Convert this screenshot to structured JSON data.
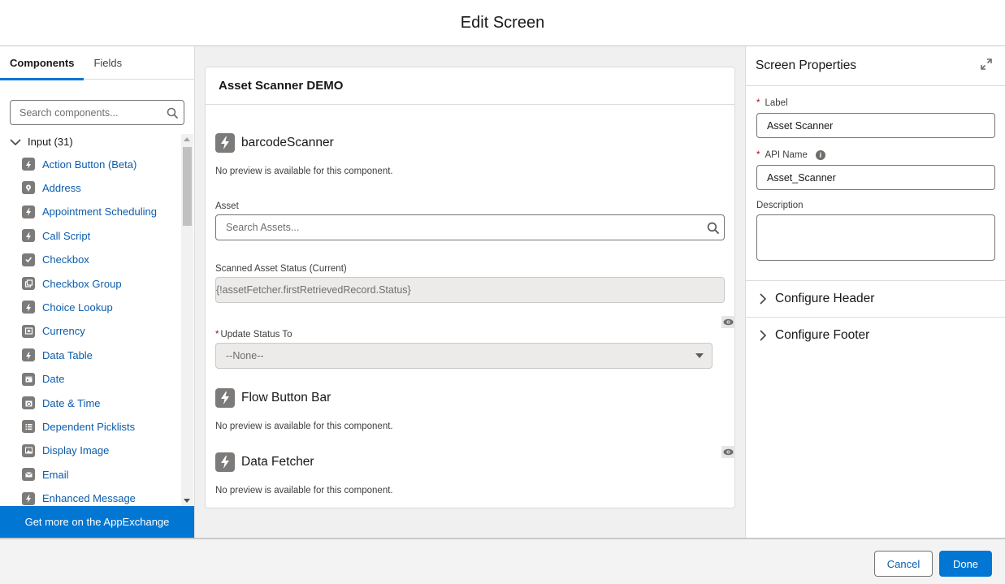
{
  "window": {
    "title": "Edit Screen"
  },
  "left_panel": {
    "tabs": [
      {
        "label": "Components",
        "active": true
      },
      {
        "label": "Fields",
        "active": false
      }
    ],
    "search": {
      "placeholder": "Search components...",
      "value": ""
    },
    "group": {
      "label": "Input (31)",
      "expanded": true
    },
    "items": [
      {
        "label": "Action Button (Beta)",
        "icon": "bolt-icon"
      },
      {
        "label": "Address",
        "icon": "location-pin-icon"
      },
      {
        "label": "Appointment Scheduling",
        "icon": "bolt-icon"
      },
      {
        "label": "Call Script",
        "icon": "bolt-icon"
      },
      {
        "label": "Checkbox",
        "icon": "checkbox-icon"
      },
      {
        "label": "Checkbox Group",
        "icon": "checkbox-group-icon"
      },
      {
        "label": "Choice Lookup",
        "icon": "bolt-icon"
      },
      {
        "label": "Currency",
        "icon": "currency-icon"
      },
      {
        "label": "Data Table",
        "icon": "bolt-icon"
      },
      {
        "label": "Date",
        "icon": "calendar-icon"
      },
      {
        "label": "Date & Time",
        "icon": "calendar-time-icon"
      },
      {
        "label": "Dependent Picklists",
        "icon": "list-icon"
      },
      {
        "label": "Display Image",
        "icon": "image-icon"
      },
      {
        "label": "Email",
        "icon": "email-icon"
      },
      {
        "label": "Enhanced Message",
        "icon": "bolt-icon"
      }
    ],
    "appexchange_label": "Get more on the AppExchange"
  },
  "canvas": {
    "screen_title": "Asset Scanner DEMO",
    "components": [
      {
        "name": "barcodeScanner",
        "note": "No preview is available for this component."
      },
      {
        "name": "Flow Button Bar",
        "note": "No preview is available for this component."
      },
      {
        "name": "Data Fetcher",
        "note": "No preview is available for this component."
      }
    ],
    "asset_field": {
      "label": "Asset",
      "placeholder": "Search Assets..."
    },
    "status_field": {
      "label": "Scanned Asset Status (Current)",
      "value": "{!assetFetcher.firstRetrievedRecord.Status}"
    },
    "update_field": {
      "required_mark": "*",
      "label": "Update Status To",
      "value": "--None--"
    }
  },
  "properties": {
    "title": "Screen Properties",
    "label_field": {
      "required_mark": "*",
      "label": "Label",
      "value": "Asset Scanner"
    },
    "api_field": {
      "required_mark": "*",
      "label": "API Name",
      "value": "Asset_Scanner",
      "info_glyph": "i"
    },
    "description_field": {
      "label": "Description",
      "value": ""
    },
    "sections": [
      {
        "label": "Configure Header"
      },
      {
        "label": "Configure Footer"
      }
    ]
  },
  "footer": {
    "cancel_label": "Cancel",
    "done_label": "Done"
  },
  "colors": {
    "brand": "#0176d3",
    "link": "#0b5cab",
    "icon_gray": "#7d7b79",
    "required": "#ba0517"
  }
}
